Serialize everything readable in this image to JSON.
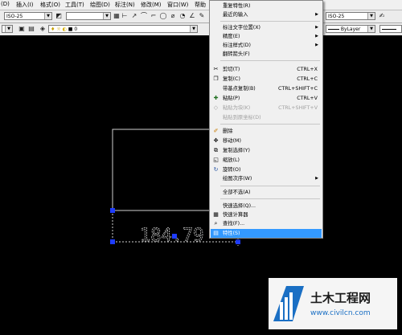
{
  "menubar": {
    "items": [
      "(D)",
      "插入(I)",
      "格式(O)",
      "工具(T)",
      "绘图(D)",
      "标注(N)",
      "修改(M)",
      "窗口(W)",
      "帮助"
    ]
  },
  "toolbar": {
    "dim_style_left": "ISO-25",
    "dim_style_right": "ISO-25",
    "layer_value": "0",
    "bylayer": "ByLayer"
  },
  "context_menu": {
    "items": [
      {
        "label": "重复特性(R)",
        "shortcut": "",
        "submenu": false,
        "disabled": false,
        "icon": ""
      },
      {
        "label": "最近的输入",
        "shortcut": "",
        "submenu": true,
        "disabled": false,
        "icon": ""
      },
      {
        "label": "标注文字位置(X)",
        "shortcut": "",
        "submenu": true,
        "disabled": false,
        "icon": ""
      },
      {
        "label": "精度(E)",
        "shortcut": "",
        "submenu": true,
        "disabled": false,
        "icon": ""
      },
      {
        "label": "标注样式(D)",
        "shortcut": "",
        "submenu": true,
        "disabled": false,
        "icon": ""
      },
      {
        "label": "翻转箭头(F)",
        "shortcut": "",
        "submenu": false,
        "disabled": false,
        "icon": ""
      },
      {
        "label": "剪切(T)",
        "shortcut": "CTRL+X",
        "submenu": false,
        "disabled": false,
        "icon": "cut"
      },
      {
        "label": "复制(C)",
        "shortcut": "CTRL+C",
        "submenu": false,
        "disabled": false,
        "icon": "copy"
      },
      {
        "label": "带基点复制(B)",
        "shortcut": "CTRL+SHIFT+C",
        "submenu": false,
        "disabled": false,
        "icon": ""
      },
      {
        "label": "粘贴(P)",
        "shortcut": "CTRL+V",
        "submenu": false,
        "disabled": false,
        "icon": "paste"
      },
      {
        "label": "粘贴为块(K)",
        "shortcut": "CTRL+SHIFT+V",
        "submenu": false,
        "disabled": true,
        "icon": ""
      },
      {
        "label": "粘贴到原坐标(D)",
        "shortcut": "",
        "submenu": false,
        "disabled": true,
        "icon": ""
      },
      {
        "label": "删除",
        "shortcut": "",
        "submenu": false,
        "disabled": false,
        "icon": "erase"
      },
      {
        "label": "移动(M)",
        "shortcut": "",
        "submenu": false,
        "disabled": false,
        "icon": "move"
      },
      {
        "label": "复制选择(Y)",
        "shortcut": "",
        "submenu": false,
        "disabled": false,
        "icon": "copysel"
      },
      {
        "label": "缩放(L)",
        "shortcut": "",
        "submenu": false,
        "disabled": false,
        "icon": "scale"
      },
      {
        "label": "旋转(O)",
        "shortcut": "",
        "submenu": false,
        "disabled": false,
        "icon": "rotate"
      },
      {
        "label": "绘图次序(W)",
        "shortcut": "",
        "submenu": true,
        "disabled": false,
        "icon": ""
      },
      {
        "label": "全部不选(A)",
        "shortcut": "",
        "submenu": false,
        "disabled": false,
        "icon": ""
      },
      {
        "label": "快速选择(Q)...",
        "shortcut": "",
        "submenu": false,
        "disabled": false,
        "icon": ""
      },
      {
        "label": "快速计算器",
        "shortcut": "",
        "submenu": false,
        "disabled": false,
        "icon": "calc"
      },
      {
        "label": "查找(F)...",
        "shortcut": "",
        "submenu": false,
        "disabled": false,
        "icon": "find"
      },
      {
        "label": "特性(S)",
        "shortcut": "",
        "submenu": false,
        "disabled": false,
        "icon": "props",
        "highlighted": true
      }
    ]
  },
  "drawing": {
    "dimension_text": "184.79"
  },
  "watermark": {
    "title": "土木工程网",
    "url": "www.civilcn.com"
  }
}
